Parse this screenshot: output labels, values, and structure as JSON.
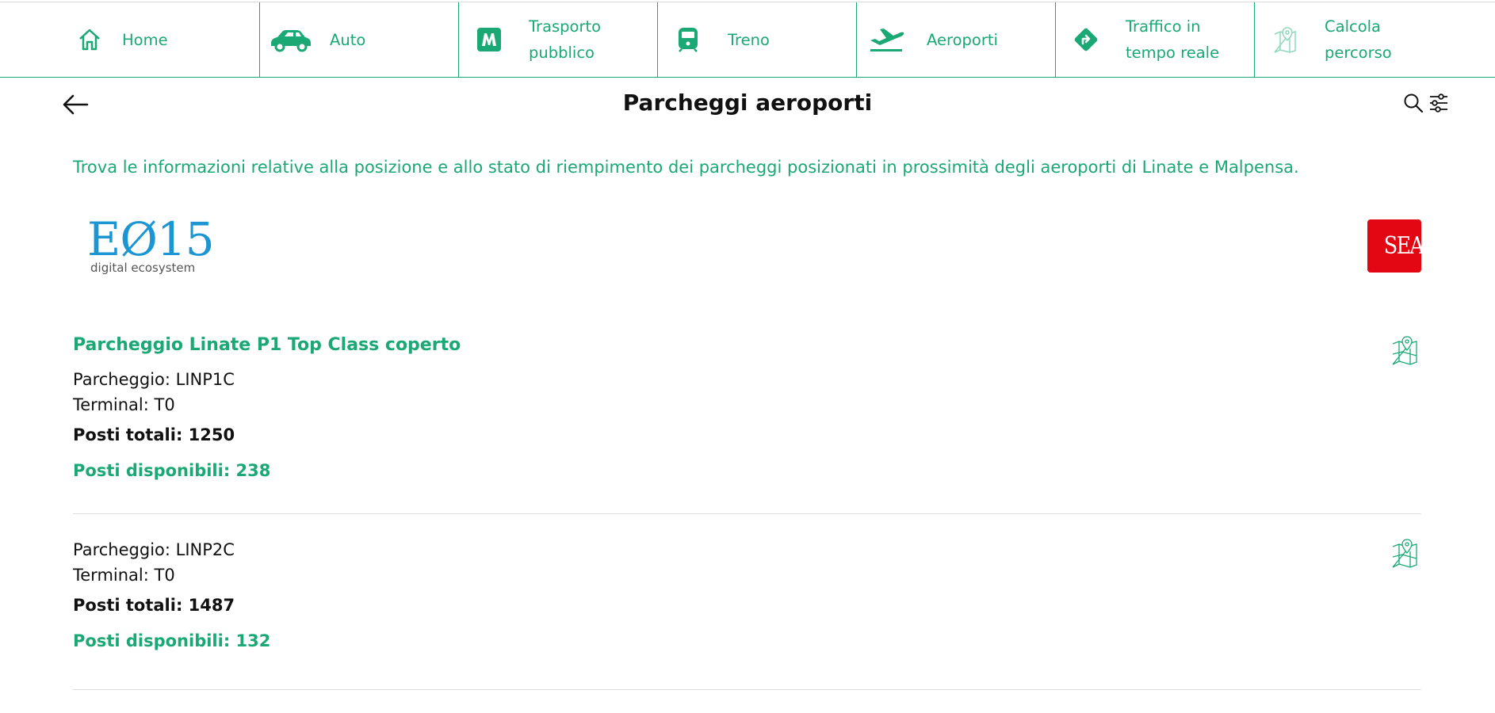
{
  "nav": {
    "items": [
      {
        "label": "Home",
        "icon": "home-icon"
      },
      {
        "label": "Auto",
        "icon": "car-icon"
      },
      {
        "label": "Trasporto pubblico",
        "icon": "metro-icon"
      },
      {
        "label": "Treno",
        "icon": "train-icon"
      },
      {
        "label": "Aeroporti",
        "icon": "airplane-icon"
      },
      {
        "label": "Traffico in tempo reale",
        "icon": "traffic-icon"
      },
      {
        "label": "Calcola percorso",
        "icon": "map-pin-icon"
      }
    ]
  },
  "header": {
    "title": "Parcheggi aeroporti",
    "back_icon": "arrow-left-icon",
    "search_icon": "search-icon",
    "filter_icon": "filter-sliders-icon"
  },
  "intro": "Trova le informazioni relative alla posizione e allo stato di riempimento dei parcheggi posizionati in prossimità degli aeroporti di Linate e Malpensa.",
  "logos": {
    "e015_main": "EØ15",
    "e015_sub": "digital ecosystem",
    "sea": "SEA"
  },
  "parkings": [
    {
      "name": "Parcheggio Linate P1 Top Class coperto",
      "code": "Parcheggio: LINP1C",
      "terminal": "Terminal: T0",
      "total": "Posti totali: 1250",
      "available": "Posti disponibili: 238"
    },
    {
      "name": "",
      "code": "Parcheggio: LINP2C",
      "terminal": "Terminal: T0",
      "total": "Posti totali: 1487",
      "available": "Posti disponibili: 132"
    }
  ],
  "colors": {
    "accent": "#1aa874",
    "e015_blue": "#1b96d3",
    "sea_red": "#e30613"
  }
}
